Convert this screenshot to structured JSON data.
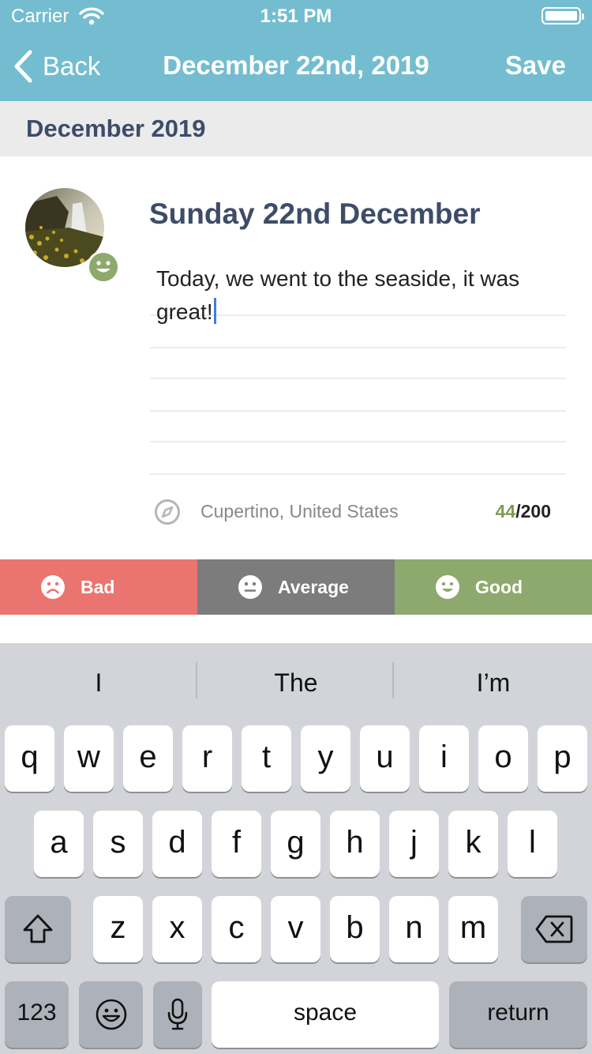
{
  "status": {
    "carrier": "Carrier",
    "time": "1:51 PM"
  },
  "nav": {
    "back_label": "Back",
    "title": "December 22nd, 2019",
    "save_label": "Save"
  },
  "section": {
    "title": "December 2019"
  },
  "entry": {
    "day_title": "Sunday 22nd December",
    "text": "Today, we went to the seaside, it was great!",
    "location": "Cupertino, United States",
    "char_count": "44",
    "char_limit": "/200",
    "current_mood_icon": "smile-icon"
  },
  "moods": [
    {
      "label": "Bad",
      "icon": "sad-face-icon",
      "color": "#ea7470"
    },
    {
      "label": "Average",
      "icon": "neutral-face-icon",
      "color": "#7c7c7c"
    },
    {
      "label": "Good",
      "icon": "happy-face-icon",
      "color": "#8ea96d"
    }
  ],
  "keyboard": {
    "suggestions": [
      "I",
      "The",
      "I’m"
    ],
    "row1": [
      "q",
      "w",
      "e",
      "r",
      "t",
      "y",
      "u",
      "i",
      "o",
      "p"
    ],
    "row2": [
      "a",
      "s",
      "d",
      "f",
      "g",
      "h",
      "j",
      "k",
      "l"
    ],
    "row3": [
      "z",
      "x",
      "c",
      "v",
      "b",
      "n",
      "m"
    ],
    "numbers_label": "123",
    "space_label": "space",
    "return_label": "return"
  },
  "colors": {
    "nav_bar": "#74bdd0",
    "heading": "#3e4c68",
    "accent_green": "#7d9d55",
    "caret": "#3f7ce9"
  }
}
